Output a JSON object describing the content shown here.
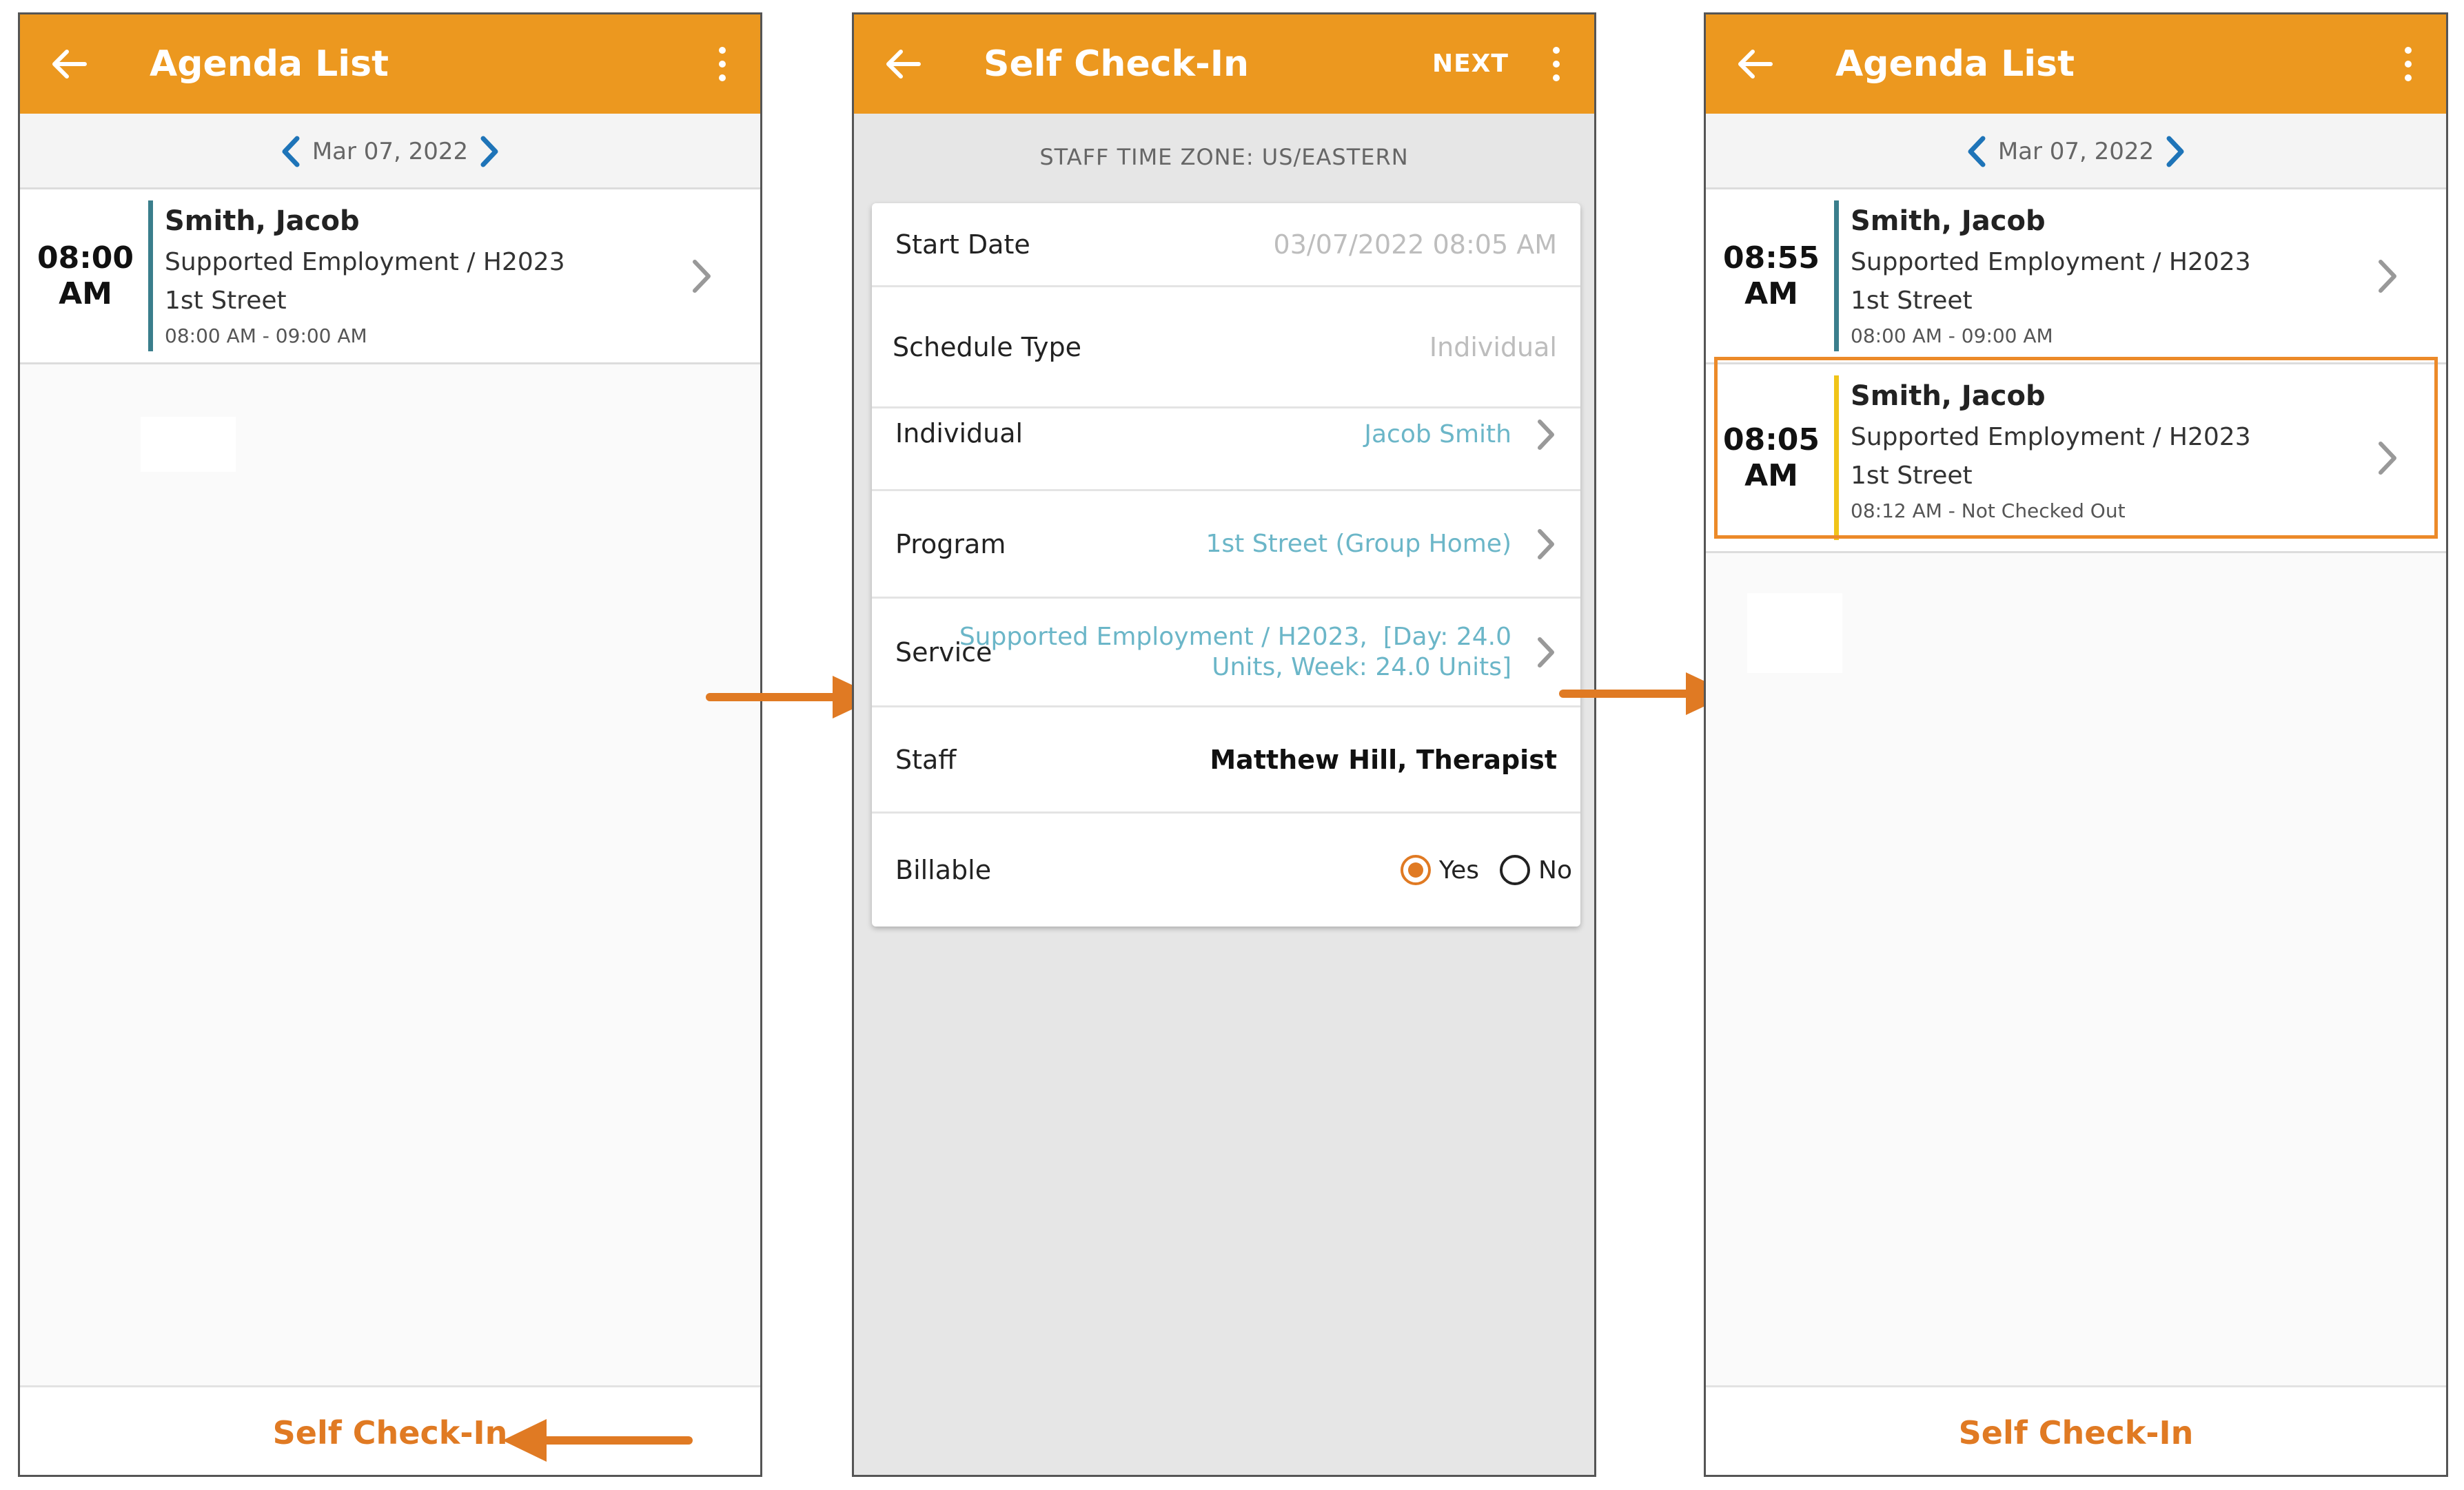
{
  "colors": {
    "accent": "#ec981f",
    "link": "#e07a23",
    "value_link": "#6bb6c8",
    "highlight": "#ec8a29"
  },
  "screen1": {
    "title": "Agenda List",
    "date": "Mar 07, 2022",
    "items": [
      {
        "time_hour": "08:00",
        "time_period": "AM",
        "name": "Smith, Jacob",
        "service": "Supported Employment / H2023",
        "location": "1st Street",
        "times": "08:00 AM - 09:00 AM"
      }
    ],
    "bottom_link": "Self Check-In"
  },
  "screen2": {
    "title": "Self Check-In",
    "next_label": "NEXT",
    "timezone": "STAFF TIME ZONE: US/EASTERN",
    "fields": {
      "start_date": {
        "label": "Start Date",
        "value": "03/07/2022 08:05 AM"
      },
      "schedule_type": {
        "label": "Schedule Type",
        "value": "Individual"
      },
      "individual": {
        "label": "Individual",
        "value": "Jacob Smith"
      },
      "program": {
        "label": "Program",
        "value": "1st Street (Group Home)"
      },
      "service": {
        "label": "Service",
        "value_line1": "Supported Employment / H2023,  [Day: 24.0",
        "value_line2": "Units, Week: 24.0 Units]"
      },
      "staff": {
        "label": "Staff",
        "value": "Matthew Hill, Therapist"
      },
      "billable": {
        "label": "Billable",
        "option_yes": "Yes",
        "option_no": "No",
        "selected": "Yes"
      }
    }
  },
  "screen3": {
    "title": "Agenda List",
    "date": "Mar 07, 2022",
    "items": [
      {
        "time_hour": "08:55",
        "time_period": "AM",
        "name": "Smith, Jacob",
        "service": "Supported Employment / H2023",
        "location": "1st Street",
        "times": "08:00 AM - 09:00 AM"
      },
      {
        "time_hour": "08:05",
        "time_period": "AM",
        "name": "Smith, Jacob",
        "service": "Supported Employment / H2023",
        "location": "1st Street",
        "times": "08:12 AM - Not Checked Out"
      }
    ],
    "bottom_link": "Self Check-In"
  }
}
